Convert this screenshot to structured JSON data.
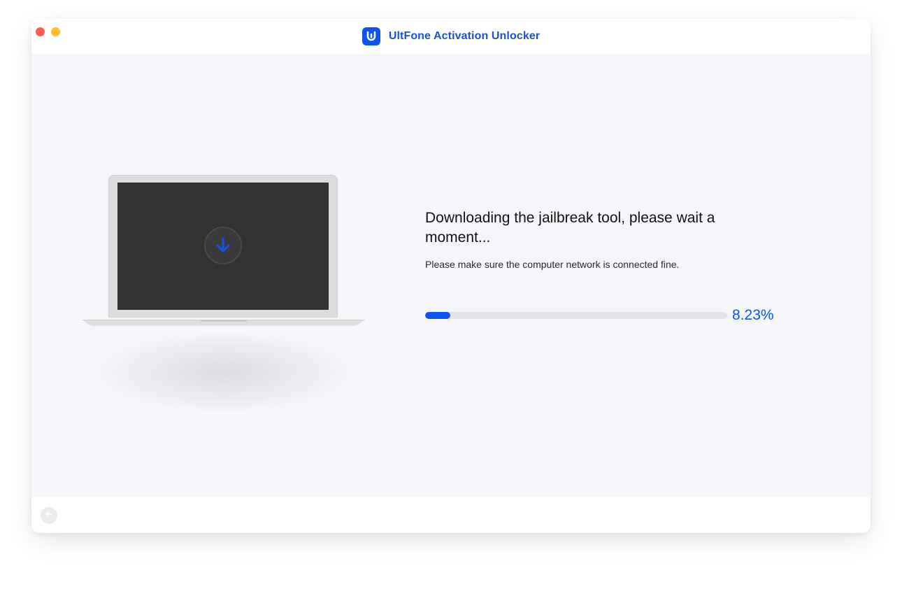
{
  "app": {
    "title": "UltFone Activation Unlocker",
    "logo_icon": "ultfone-logo-icon"
  },
  "colors": {
    "accent": "#0f52f0",
    "title_text": "#1a54d6",
    "content_bg": "#f5f6fa",
    "progress_track": "#e3e4e8"
  },
  "main": {
    "heading": "Downloading the jailbreak tool, please wait a moment...",
    "subtext": "Please make sure the computer network is connected fine.",
    "illustration_icon": "download-arrow-icon"
  },
  "progress": {
    "fraction": 0.0823,
    "label": "8.23%"
  },
  "footer": {
    "back_icon": "back-arrow-icon"
  }
}
